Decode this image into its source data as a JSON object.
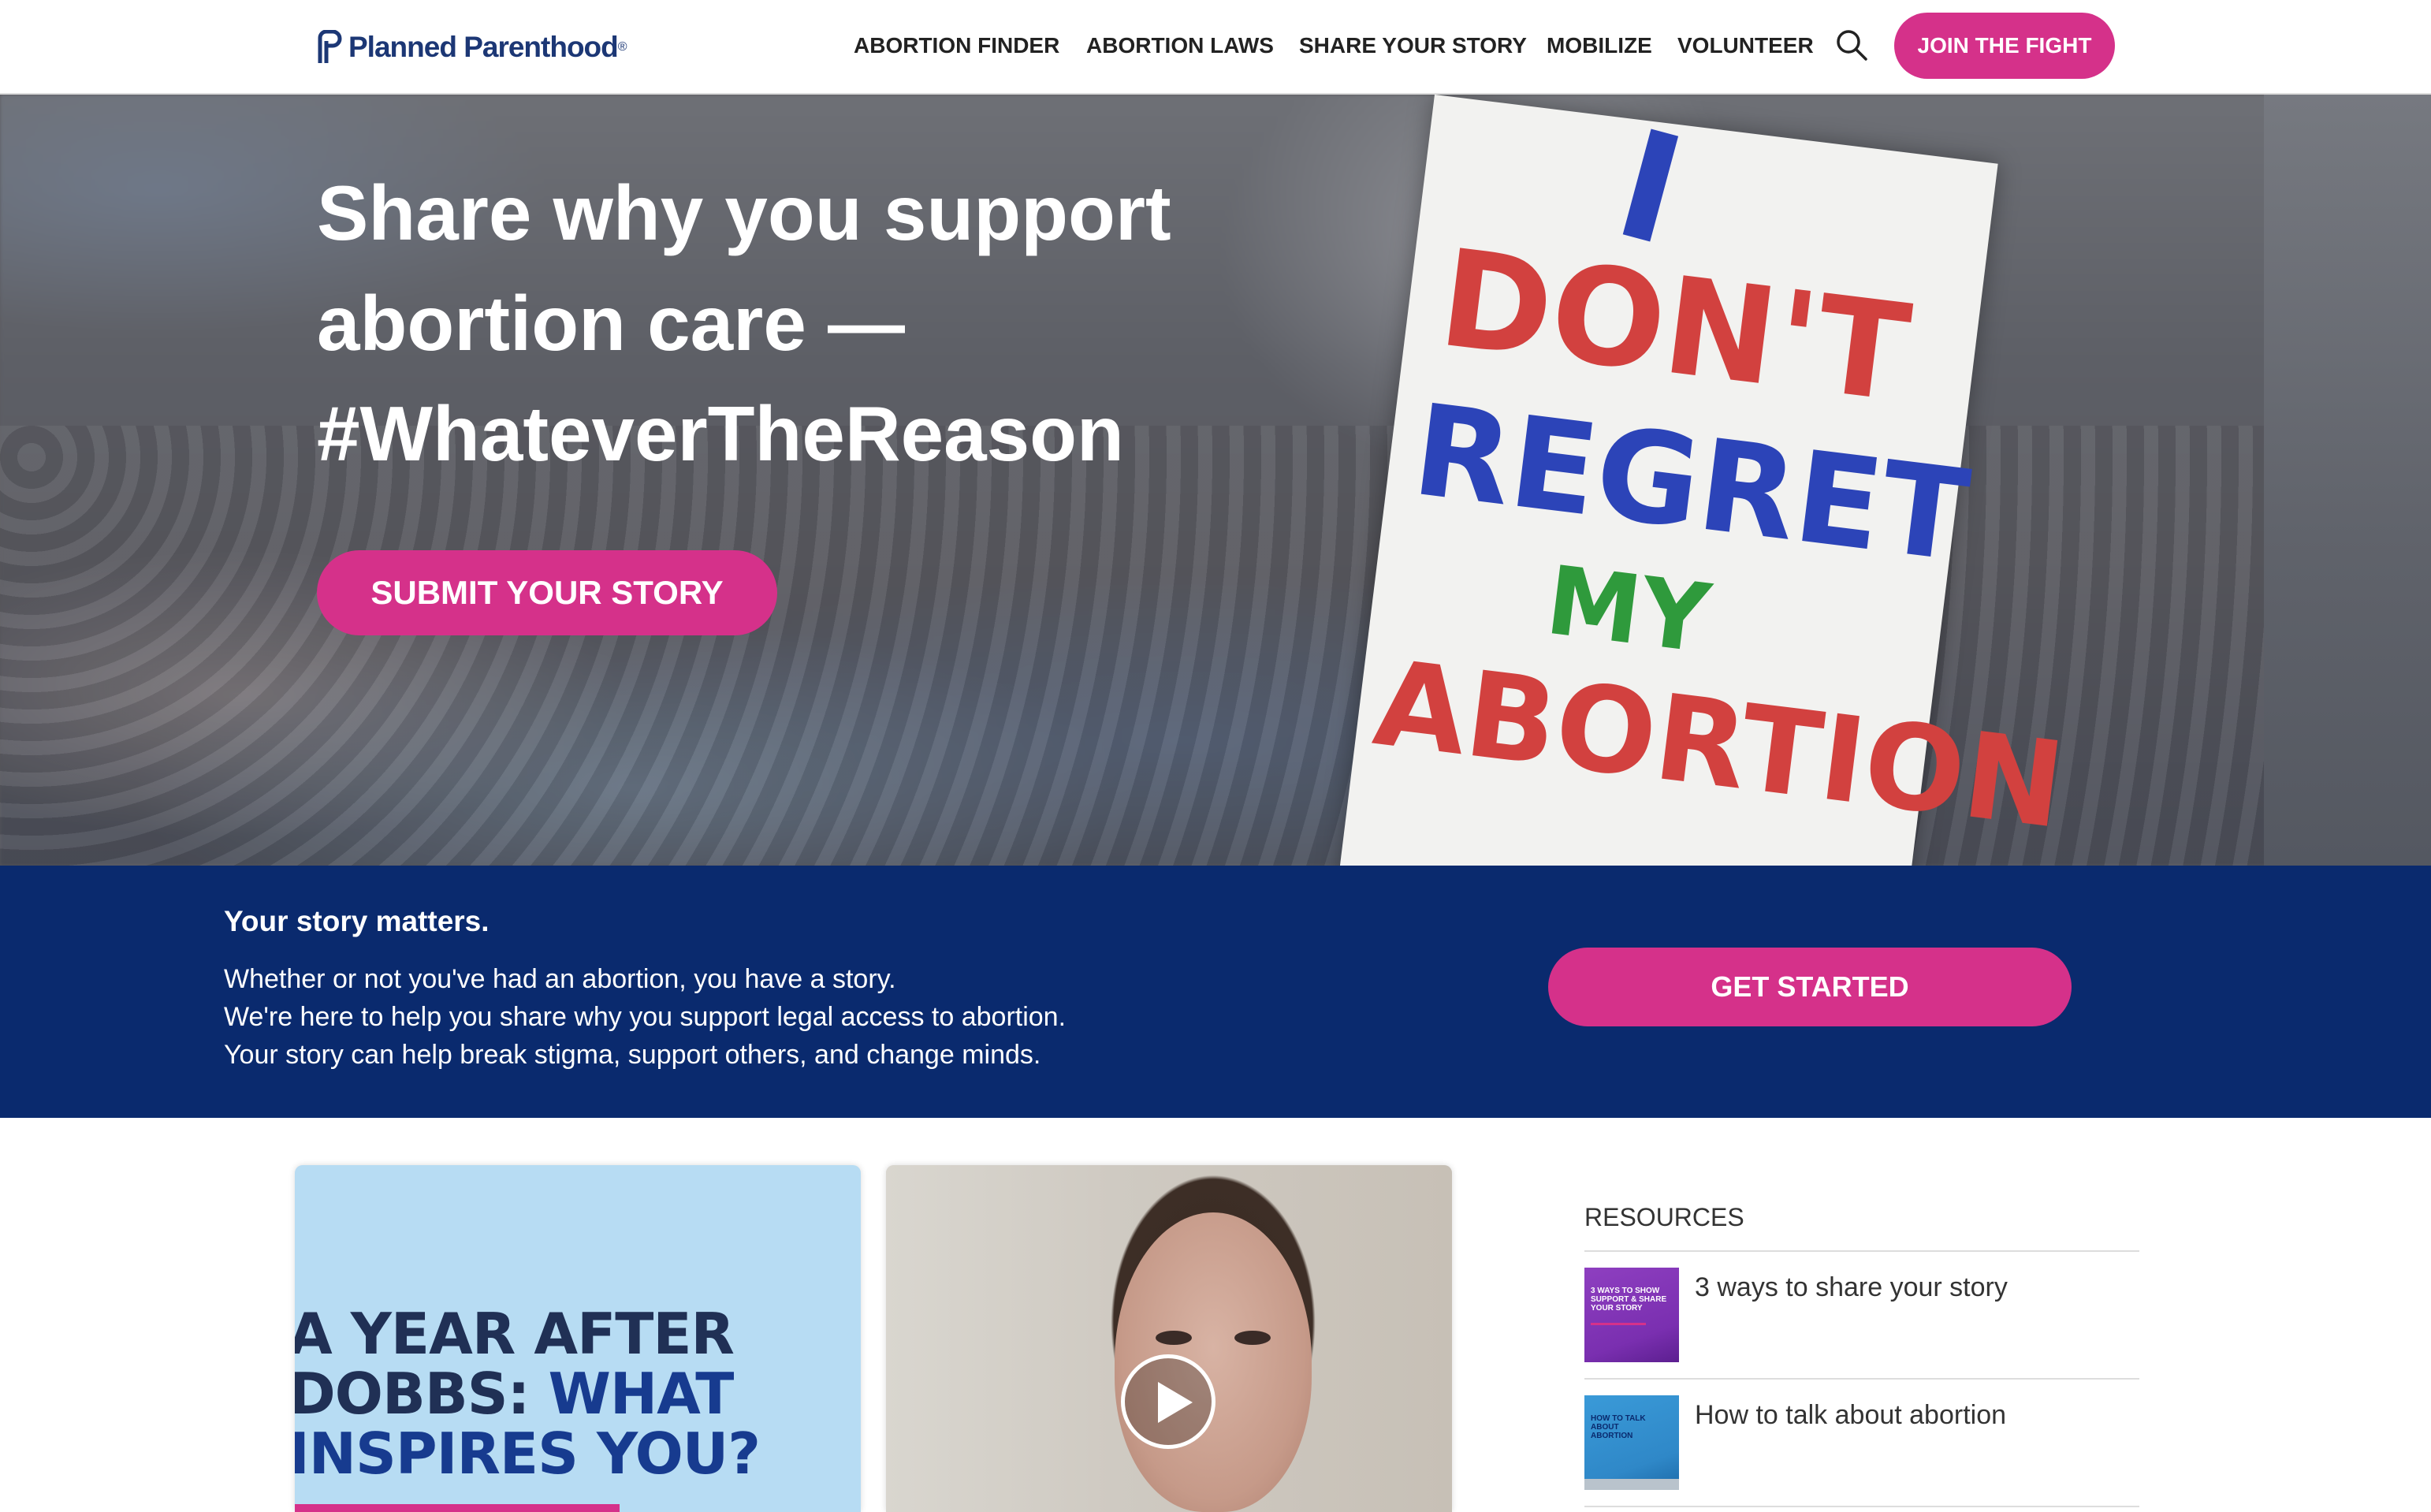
{
  "header": {
    "logo_text": "Planned Parenthood",
    "logo_reg": "®",
    "nav": [
      {
        "label": "ABORTION FINDER"
      },
      {
        "label": "ABORTION LAWS"
      },
      {
        "label": "SHARE YOUR STORY"
      },
      {
        "label": "MOBILIZE"
      },
      {
        "label": "VOLUNTEER"
      }
    ],
    "search_icon": "search-icon",
    "join_label": "JOIN THE FIGHT"
  },
  "hero": {
    "title_lines": [
      "Share why you support",
      "abortion care —",
      "#WhateverTheReason"
    ],
    "submit_label": "SUBMIT YOUR STORY",
    "sign_words": [
      "I",
      "DON'T",
      "REGRET",
      "MY",
      "ABORTION"
    ]
  },
  "band": {
    "heading": "Your story matters.",
    "lines": [
      "Whether or not you've had an abortion, you have a story.",
      "We're here to help you share why you support legal access to abortion.",
      "Your story can help break stigma, support others, and change minds."
    ],
    "cta_label": "GET STARTED"
  },
  "cards": {
    "card1": {
      "line1": "A YEAR AFTER",
      "line2_a": "DOBBS: ",
      "line2_b": "WHAT",
      "line3": "INSPIRES YOU?"
    },
    "card2": {
      "play_icon": "play-icon"
    }
  },
  "resources": {
    "heading": "RESOURCES",
    "items": [
      {
        "label": "3 ways to share your story",
        "thumb_text": "3 WAYS TO SHOW SUPPORT & SHARE YOUR STORY"
      },
      {
        "label": "How to talk about abortion",
        "thumb_text": "HOW TO TALK ABOUT ABORTION"
      }
    ]
  },
  "colors": {
    "accent_pink": "#d5318a",
    "navy": "#0a2a6e",
    "logo_blue": "#1c3775"
  }
}
